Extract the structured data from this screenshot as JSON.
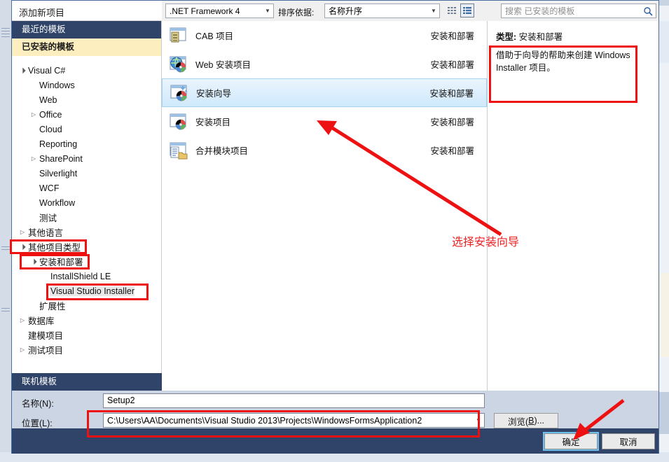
{
  "window": {
    "title": "添加新项目",
    "help_icon": "?",
    "close_icon": "✕"
  },
  "sidebar": {
    "recent_header": "最近的模板",
    "installed_header": "已安装的模板",
    "online_header": "联机模板",
    "tree": [
      {
        "label": "Visual C#",
        "indent": 0,
        "arrow": "expanded"
      },
      {
        "label": "Windows",
        "indent": 1,
        "arrow": "none"
      },
      {
        "label": "Web",
        "indent": 1,
        "arrow": "none"
      },
      {
        "label": "Office",
        "indent": 1,
        "arrow": "collapsed"
      },
      {
        "label": "Cloud",
        "indent": 1,
        "arrow": "none"
      },
      {
        "label": "Reporting",
        "indent": 1,
        "arrow": "none"
      },
      {
        "label": "SharePoint",
        "indent": 1,
        "arrow": "collapsed"
      },
      {
        "label": "Silverlight",
        "indent": 1,
        "arrow": "none"
      },
      {
        "label": "WCF",
        "indent": 1,
        "arrow": "none"
      },
      {
        "label": "Workflow",
        "indent": 1,
        "arrow": "none"
      },
      {
        "label": "测试",
        "indent": 1,
        "arrow": "none"
      },
      {
        "label": "其他语言",
        "indent": 0,
        "arrow": "collapsed"
      },
      {
        "label": "其他项目类型",
        "indent": 0,
        "arrow": "expanded"
      },
      {
        "label": "安装和部署",
        "indent": 1,
        "arrow": "expanded"
      },
      {
        "label": "InstallShield LE",
        "indent": 2,
        "arrow": "none"
      },
      {
        "label": "Visual Studio Installer",
        "indent": 2,
        "arrow": "none",
        "selected": true
      },
      {
        "label": "扩展性",
        "indent": 1,
        "arrow": "none"
      },
      {
        "label": "数据库",
        "indent": 0,
        "arrow": "collapsed"
      },
      {
        "label": "建模项目",
        "indent": 0,
        "arrow": "none"
      },
      {
        "label": "测试项目",
        "indent": 0,
        "arrow": "collapsed"
      }
    ]
  },
  "toolbar": {
    "framework": ".NET Framework 4",
    "sort_label": "排序依据:",
    "sort_value": "名称升序",
    "view_small_icon": "small-icons-view",
    "view_large_icon": "large-icons-view",
    "search_placeholder": "搜索 已安装的模板",
    "search_icon": "search-icon"
  },
  "templates": {
    "category_header": "安装和部署",
    "items": [
      {
        "name": "CAB 项目",
        "category": "安装和部署",
        "icon": "cab-project-icon",
        "selected": false
      },
      {
        "name": "Web 安装项目",
        "category": "安装和部署",
        "icon": "web-setup-project-icon",
        "selected": false
      },
      {
        "name": "安装向导",
        "category": "安装和部署",
        "icon": "setup-wizard-icon",
        "selected": true
      },
      {
        "name": "安装项目",
        "category": "安装和部署",
        "icon": "setup-project-icon",
        "selected": false
      },
      {
        "name": "合并模块项目",
        "category": "安装和部署",
        "icon": "merge-module-icon",
        "selected": false
      }
    ]
  },
  "description": {
    "type_label": "类型:",
    "type_value": "安装和部署",
    "text": "借助于向导的帮助来创建 Windows Installer 项目。"
  },
  "fields": {
    "name_label": "名称(N):",
    "name_value": "Setup2",
    "location_label": "位置(L):",
    "location_value": "C:\\Users\\AA\\Documents\\Visual Studio 2013\\Projects\\WindowsFormsApplication2",
    "browse_prefix": "浏览(",
    "browse_key": "B",
    "browse_suffix": ")..."
  },
  "buttons": {
    "ok": "确定",
    "cancel": "取消"
  },
  "annotations": {
    "note": "选择安装向导",
    "color": "#ee1111"
  },
  "colors": {
    "header_blue": "#2f4468",
    "installed_yellow": "#fdeec0",
    "selection_blue": "#cfe9fb",
    "field_bar": "#ccd5e4",
    "annotation_red": "#ee1111"
  }
}
